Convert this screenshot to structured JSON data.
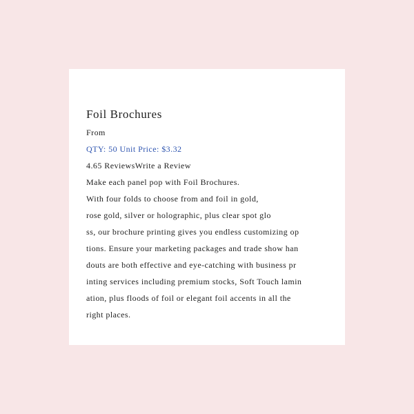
{
  "product": {
    "title": "Foil Brochures",
    "from_label": "From",
    "price_text": "QTY: 50 Unit Price: $3.32",
    "rating": "4.65",
    "reviews_label": " Reviews",
    "write_review_label": "Write a Review",
    "description_lines": [
      "Make each panel pop with Foil Brochures.",
      " With four folds to choose from and foil in gold,",
      "rose gold, silver or holographic, plus clear spot glo",
      "ss, our brochure printing gives you endless customizing op",
      "tions. Ensure your marketing packages and trade show han",
      "douts are both effective and eye-catching with business pr",
      "inting services including premium stocks, Soft Touch lamin",
      "ation, plus floods of foil or elegant foil accents in all the",
      "right places."
    ]
  },
  "colors": {
    "page_background": "#f8e6e7",
    "card_background": "#ffffff",
    "price_text": "#2f55b0"
  }
}
